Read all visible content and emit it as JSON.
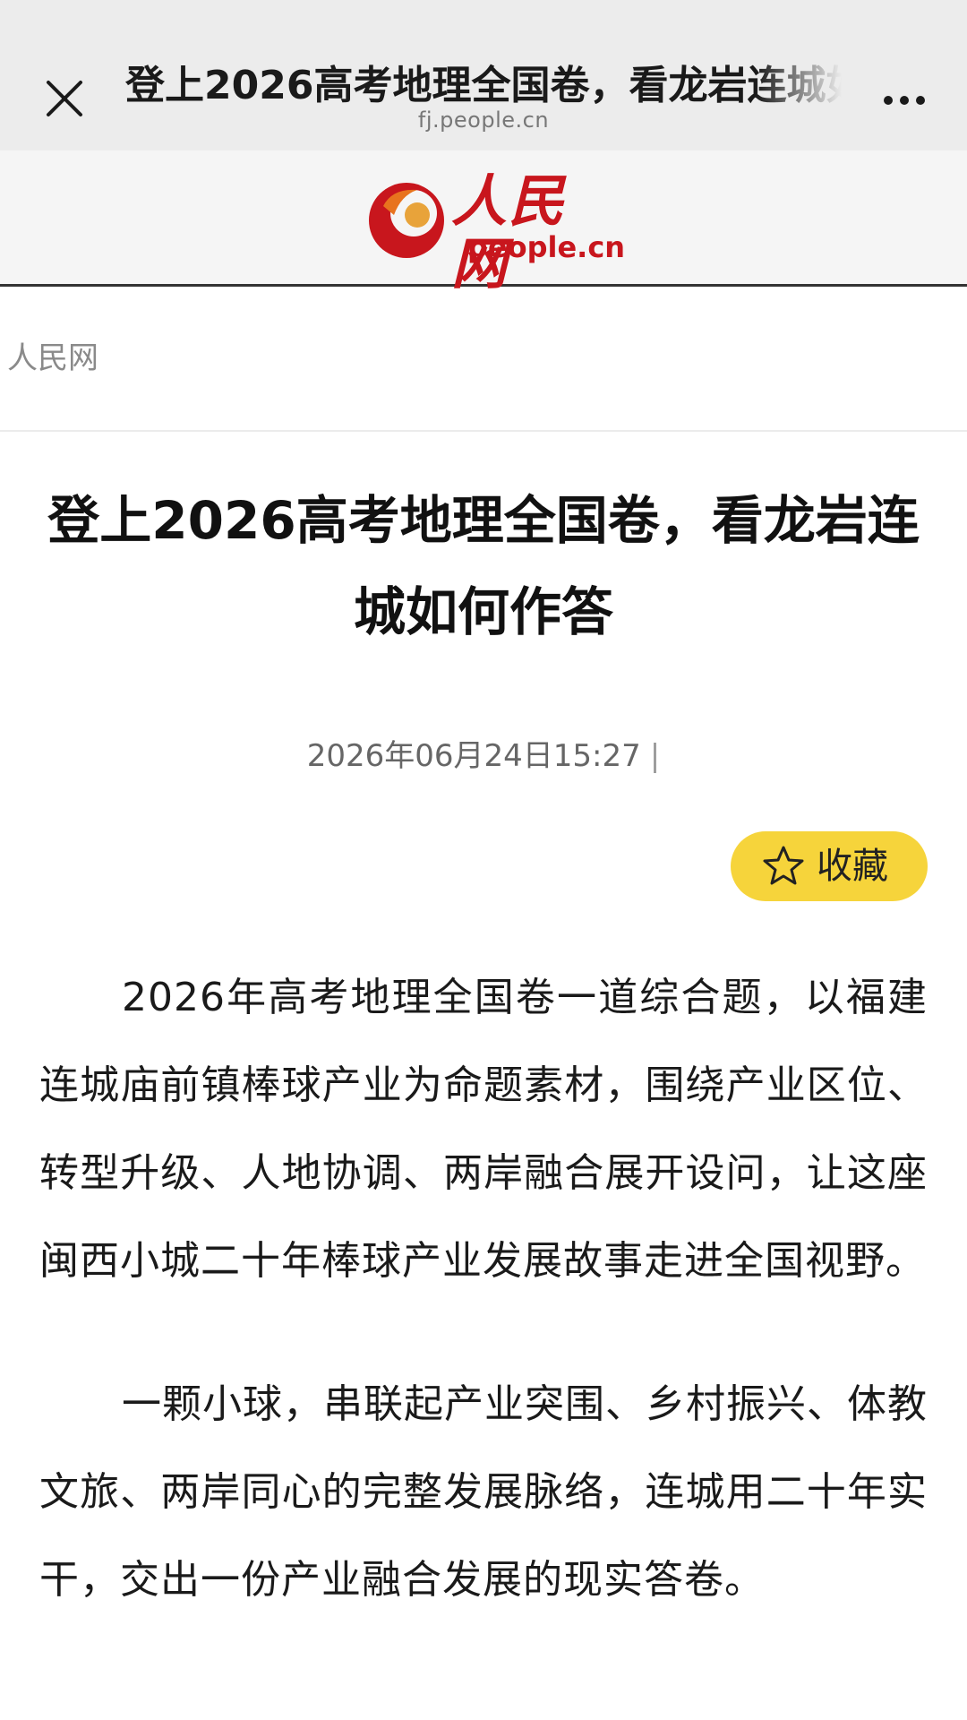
{
  "browser": {
    "page_title": "登上2026高考地理全国卷，看龙岩连城如何作答",
    "domain": "fj.people.cn"
  },
  "site": {
    "logo_text": "人民网",
    "logo_sub": "people.cn",
    "brand_color": "#c8161d"
  },
  "article": {
    "source": "人民网",
    "headline": "登上2026高考地理全国卷，看龙岩连城如何作答",
    "published": "2026年06月24日15:27",
    "favorite_label": "收藏",
    "paragraphs": [
      "2026年高考地理全国卷一道综合题，以福建连城庙前镇棒球产业为命题素材，围绕产业区位、转型升级、人地协调、两岸融合展开设问，让这座闽西小城二十年棒球产业发展故事走进全国视野。",
      "一颗小球，串联起产业突围、乡村振兴、体教文旅、两岸同心的完整发展脉络，连城用二十年实干，交出一份产业融合发展的现实答卷。"
    ]
  },
  "colors": {
    "favorite_button": "#f6d43b",
    "top_bar": "#ececec"
  },
  "icons": {
    "close": "close-icon",
    "more": "more-icon",
    "star": "star-icon",
    "logo": "people-logo-icon"
  }
}
